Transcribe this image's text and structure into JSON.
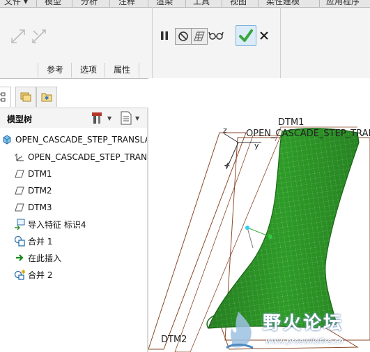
{
  "menu": {
    "tabs": [
      "文件 ▾",
      "模型",
      "分析",
      "注释",
      "渲染",
      "工具",
      "视图",
      "柔性建模",
      "应用程序"
    ]
  },
  "ribbon": {
    "subtabs": [
      "参考",
      "选项",
      "属性"
    ],
    "tools": {
      "pause": "pause-icon",
      "no_preview": "no-preview-icon",
      "verify": "verify-icon",
      "glasses": "preview-glasses-icon",
      "ok": "checkmark-icon",
      "cancel": "cancel-icon"
    },
    "colors": {
      "ok_button": "#4fb348",
      "ok_button_bg": "#d9ecf8"
    }
  },
  "tree": {
    "title": "模型树",
    "items": [
      {
        "label": "OPEN_CASCADE_STEP_TRANSLA-",
        "icon": "part-icon"
      },
      {
        "label": "OPEN_CASCADE_STEP_TRANS",
        "icon": "coordinate-system-icon"
      },
      {
        "label": "DTM1",
        "icon": "datum-plane-icon"
      },
      {
        "label": "DTM2",
        "icon": "datum-plane-icon"
      },
      {
        "label": "DTM3",
        "icon": "datum-plane-icon"
      },
      {
        "label": "导入特征 标识4",
        "icon": "import-feature-icon"
      },
      {
        "label": "合并 1",
        "icon": "merge-icon"
      },
      {
        "label": "在此插入",
        "icon": "insert-here-arrow-icon"
      },
      {
        "label": "合并 2",
        "icon": "merge-active-icon"
      }
    ]
  },
  "viewport": {
    "labels": {
      "dtm1": "DTM1",
      "dtm2": "DTM2",
      "csys": "OPEN_CASCADE_STEP_TRANSLA",
      "axis_z": "z",
      "axis_y": "y",
      "axis_x": "x"
    },
    "colors": {
      "surface": "#2e9b28",
      "surface_dark": "#1c6b18",
      "datum_edge": "#8a4a2a"
    }
  },
  "watermark": {
    "text": "野火论坛",
    "url": "www.proewildfire.cn"
  }
}
